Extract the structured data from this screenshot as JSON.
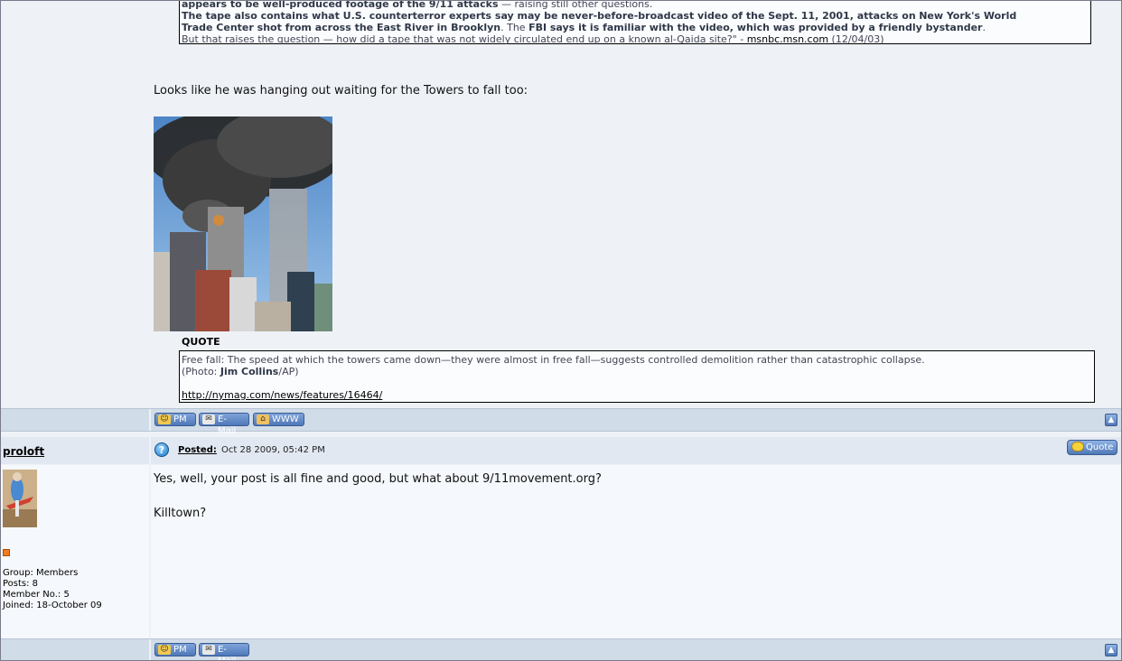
{
  "top_quote": {
    "line1_bold": "appears to be well-produced footage of the 9/11 attacks",
    "line1_rest": " — raising still other questions.",
    "line2_bold_a": "The tape also contains what U.S. counterterror experts say may be never-before-broadcast video of the Sept. 11, 2001, attacks on",
    "line2_bold_b": "New York's World",
    "line3_bold": "Trade Center shot from across the East River in Brooklyn",
    "line3_mid": ". The ",
    "line3_bold2": "FBI says it is familiar with the video, which was provided by a friendly bystander",
    "line3_end": ".",
    "line4": "But that raises the question — how did a tape that was not widely circulated end up on a known al-Qaida site?\" - ",
    "line4_link": "msnbc.msn.com",
    "line4_date": " (12/04/03)"
  },
  "post1": {
    "comment": "Looks like he was hanging out waiting for the Towers to fall too:",
    "quote_label": "QUOTE",
    "quote_line1": "Free fall: The speed at which the towers came down—they were almost in free fall—suggests controlled demolition rather than catastrophic collapse.",
    "quote_line2_pre": "(Photo: ",
    "quote_line2_bold": "Jim Collins",
    "quote_line2_post": "/AP)",
    "quote_link": "http://nymag.com/news/features/16464/"
  },
  "buttons": {
    "pm": "PM",
    "email": "E-Mail",
    "www": "WWW",
    "quote": "Quote"
  },
  "post2": {
    "username": "proloft",
    "posted_label": "Posted:",
    "posted_date": "Oct 28 2009, 05:42 PM",
    "text1": "Yes, well, your post is all fine and good, but what about 9/11movement.org?",
    "text2": "Killtown?",
    "group": "Group: Members",
    "posts": "Posts: 8",
    "member_no": "Member No.: 5",
    "joined": "Joined: 18-October 09"
  },
  "colors": {
    "bar": "#d1dce9",
    "button": "#5a82c2",
    "body_bg": "#eef2f7"
  }
}
